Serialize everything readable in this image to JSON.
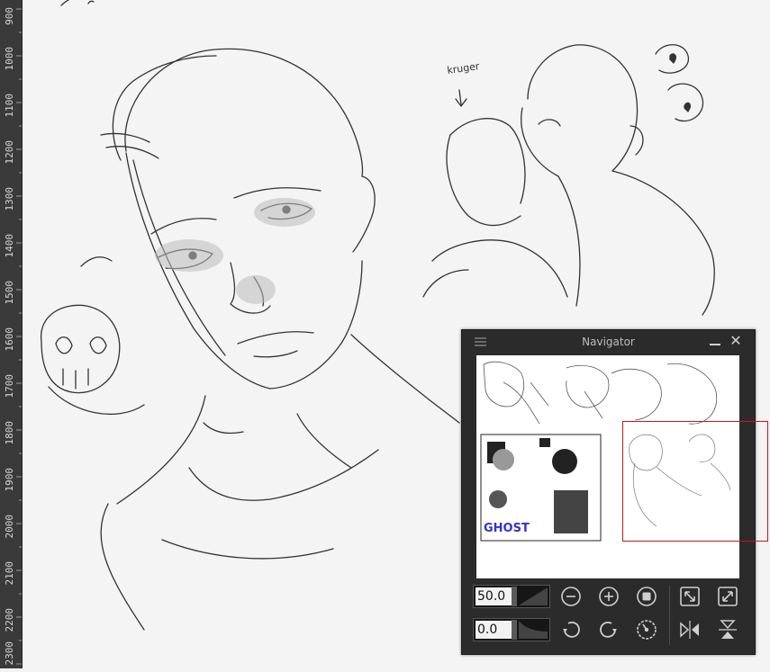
{
  "ruler": {
    "labels": [
      "900",
      "1000",
      "1100",
      "1200",
      "1300",
      "1400",
      "1500",
      "1600",
      "1700",
      "1800",
      "1900",
      "2000",
      "2100",
      "2200",
      "2300"
    ]
  },
  "canvas": {
    "annotation": "kruger"
  },
  "navigator": {
    "title": "Navigator",
    "zoom_value": "50.0",
    "rotate_value": "0.0",
    "thumbnail_text": "GHOST",
    "accent_color": "#c81818",
    "icons": [
      "menu-icon",
      "minimize-icon",
      "close-icon",
      "zoom-out-icon",
      "zoom-in-icon",
      "fit-icon",
      "fit-window-icon",
      "expand-icon",
      "rotate-left-icon",
      "rotate-right-icon",
      "reset-rotation-icon",
      "flip-horizontal-icon",
      "flip-vertical-icon"
    ]
  }
}
